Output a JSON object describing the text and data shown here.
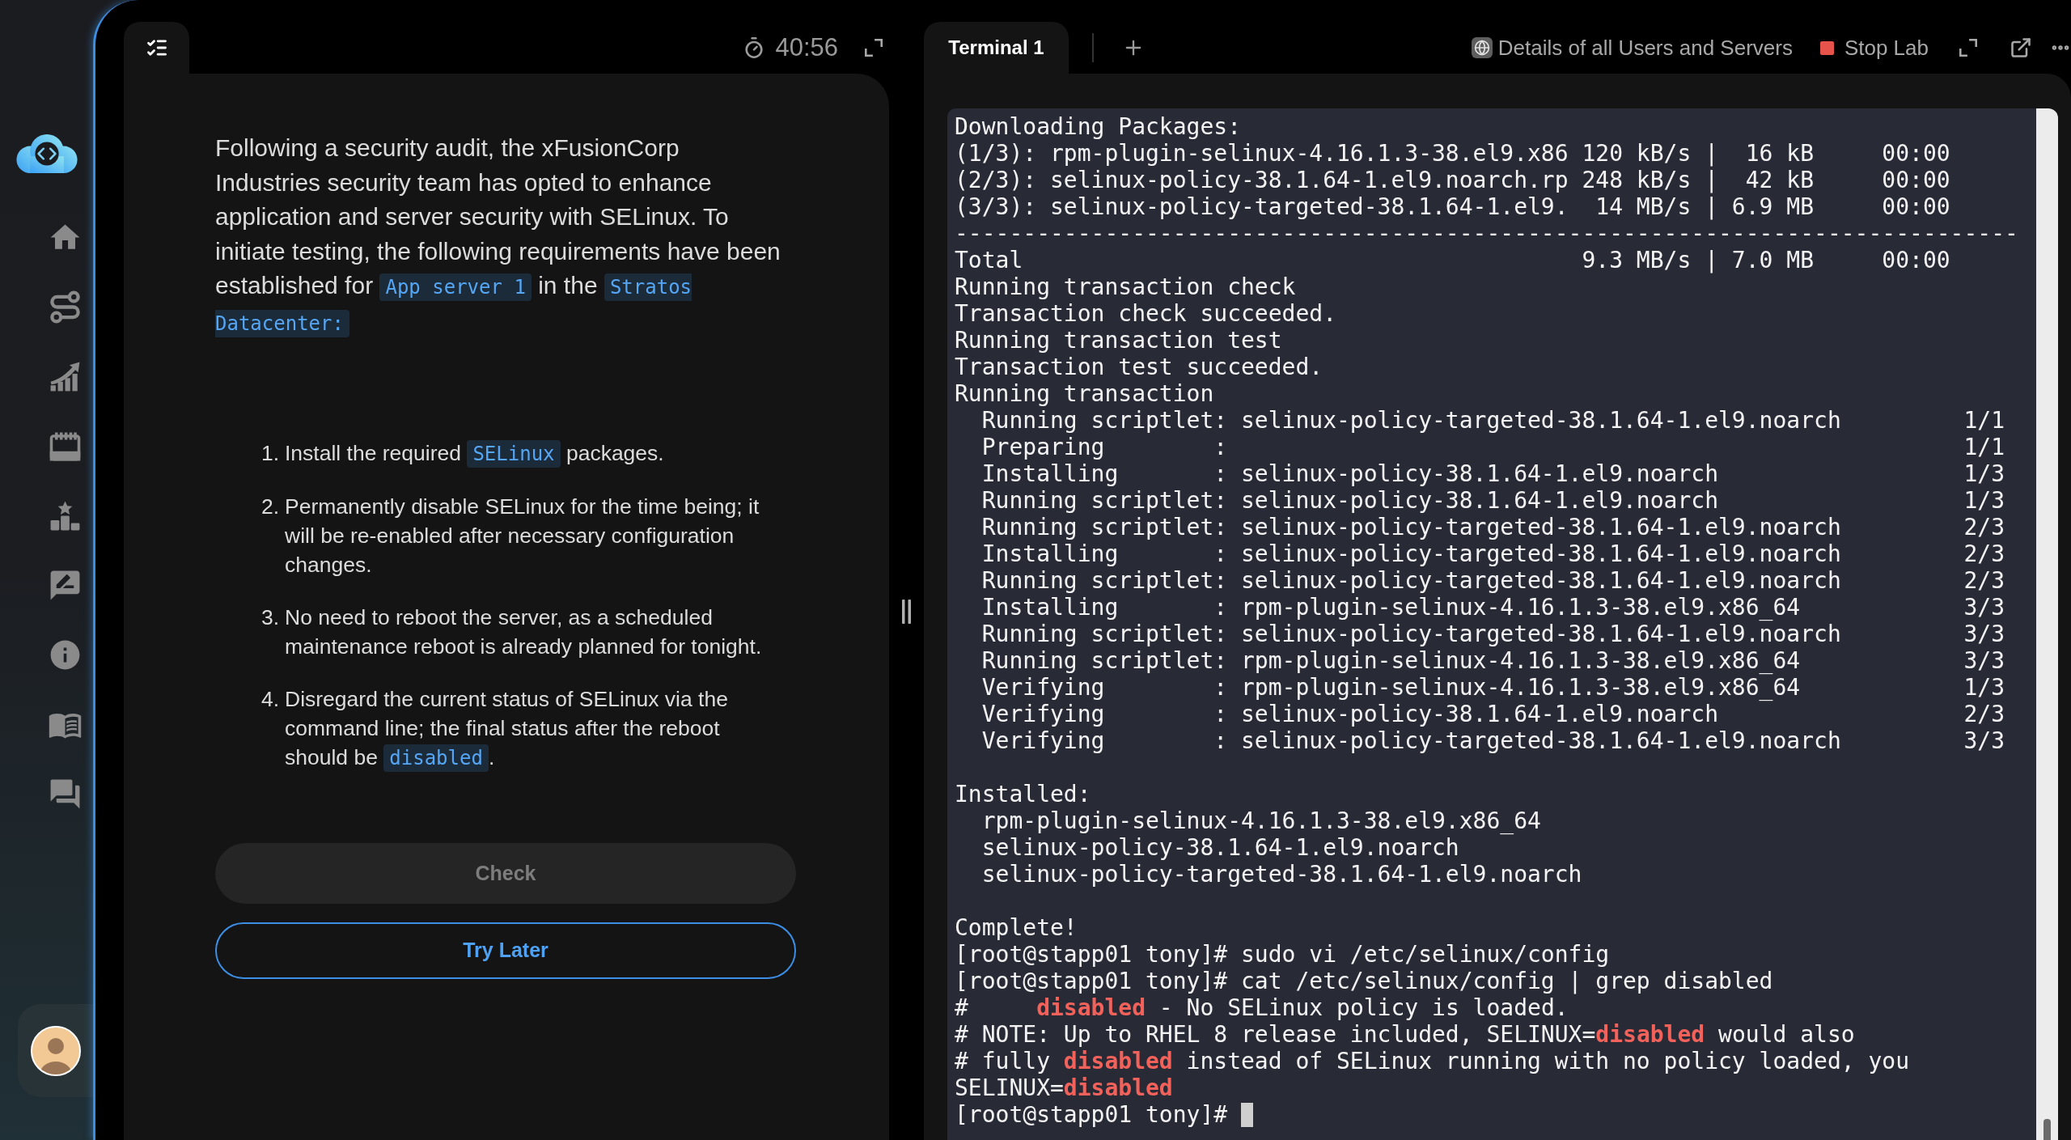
{
  "task_panel": {
    "timer": "40:56",
    "description": [
      {
        "kind": "text",
        "text": "Following a security audit, the xFusionCorp Industries security team has opted to enhance application and server security with SELinux. To initiate testing, the following requirements have been established for "
      },
      {
        "kind": "code",
        "text": "App server 1"
      },
      {
        "kind": "text",
        "text": " in the "
      },
      {
        "kind": "code",
        "text": "Stratos Datacenter:"
      }
    ],
    "steps": [
      {
        "number": "1.",
        "parts": [
          {
            "kind": "text",
            "text": "Install the required "
          },
          {
            "kind": "code",
            "text": "SELinux"
          },
          {
            "kind": "text",
            "text": " packages."
          }
        ]
      },
      {
        "number": "2.",
        "parts": [
          {
            "kind": "text",
            "text": "Permanently disable SELinux for the time being; it will be re-enabled after necessary configuration changes."
          }
        ]
      },
      {
        "number": "3.",
        "parts": [
          {
            "kind": "text",
            "text": "No need to reboot the server, as a scheduled maintenance reboot is already planned for tonight."
          }
        ]
      },
      {
        "number": "4.",
        "parts": [
          {
            "kind": "text",
            "text": "Disregard the current status of SELinux via the command line; the final status after the reboot should be "
          },
          {
            "kind": "code",
            "text": "disabled"
          },
          {
            "kind": "text",
            "text": "."
          }
        ]
      }
    ],
    "check_button": {
      "label": "Check",
      "disabled": true
    },
    "later_button": {
      "label": "Try Later"
    }
  },
  "terminal_panel": {
    "tabs": [
      {
        "label": "Terminal 1",
        "selected": true
      }
    ],
    "details_link": "Details of all Users and Servers",
    "stop_button": "Stop Lab",
    "lines": [
      {
        "kind": "text",
        "text": "Downloading Packages:"
      },
      {
        "kind": "text",
        "text": "(1/3): rpm-plugin-selinux-4.16.1.3-38.el9.x86 120 kB/s |  16 kB     00:00"
      },
      {
        "kind": "text",
        "text": "(2/3): selinux-policy-38.1.64-1.el9.noarch.rp 248 kB/s |  42 kB     00:00"
      },
      {
        "kind": "text",
        "text": "(3/3): selinux-policy-targeted-38.1.64-1.el9.  14 MB/s | 6.9 MB     00:00"
      },
      {
        "kind": "text",
        "text": "------------------------------------------------------------------------------"
      },
      {
        "kind": "text",
        "text": "Total                                         9.3 MB/s | 7.0 MB     00:00"
      },
      {
        "kind": "text",
        "text": "Running transaction check"
      },
      {
        "kind": "text",
        "text": "Transaction check succeeded."
      },
      {
        "kind": "text",
        "text": "Running transaction test"
      },
      {
        "kind": "text",
        "text": "Transaction test succeeded."
      },
      {
        "kind": "text",
        "text": "Running transaction"
      },
      {
        "kind": "text",
        "text": "  Running scriptlet: selinux-policy-targeted-38.1.64-1.el9.noarch         1/1"
      },
      {
        "kind": "text",
        "text": "  Preparing        :                                                      1/1"
      },
      {
        "kind": "text",
        "text": "  Installing       : selinux-policy-38.1.64-1.el9.noarch                  1/3"
      },
      {
        "kind": "text",
        "text": "  Running scriptlet: selinux-policy-38.1.64-1.el9.noarch                  1/3"
      },
      {
        "kind": "text",
        "text": "  Running scriptlet: selinux-policy-targeted-38.1.64-1.el9.noarch         2/3"
      },
      {
        "kind": "text",
        "text": "  Installing       : selinux-policy-targeted-38.1.64-1.el9.noarch         2/3"
      },
      {
        "kind": "text",
        "text": "  Running scriptlet: selinux-policy-targeted-38.1.64-1.el9.noarch         2/3"
      },
      {
        "kind": "text",
        "text": "  Installing       : rpm-plugin-selinux-4.16.1.3-38.el9.x86_64            3/3"
      },
      {
        "kind": "text",
        "text": "  Running scriptlet: selinux-policy-targeted-38.1.64-1.el9.noarch         3/3"
      },
      {
        "kind": "text",
        "text": "  Running scriptlet: rpm-plugin-selinux-4.16.1.3-38.el9.x86_64            3/3"
      },
      {
        "kind": "text",
        "text": "  Verifying        : rpm-plugin-selinux-4.16.1.3-38.el9.x86_64            1/3"
      },
      {
        "kind": "text",
        "text": "  Verifying        : selinux-policy-38.1.64-1.el9.noarch                  2/3"
      },
      {
        "kind": "text",
        "text": "  Verifying        : selinux-policy-targeted-38.1.64-1.el9.noarch         3/3"
      },
      {
        "kind": "blank"
      },
      {
        "kind": "text",
        "text": "Installed:"
      },
      {
        "kind": "text",
        "text": "  rpm-plugin-selinux-4.16.1.3-38.el9.x86_64"
      },
      {
        "kind": "text",
        "text": "  selinux-policy-38.1.64-1.el9.noarch"
      },
      {
        "kind": "text",
        "text": "  selinux-policy-targeted-38.1.64-1.el9.noarch"
      },
      {
        "kind": "blank"
      },
      {
        "kind": "text",
        "text": "Complete!"
      },
      {
        "kind": "text",
        "text": "[root@stapp01 tony]# sudo vi /etc/selinux/config"
      },
      {
        "kind": "text",
        "text": "[root@stapp01 tony]# cat /etc/selinux/config | grep disabled"
      },
      {
        "kind": "mixed",
        "parts": [
          {
            "kind": "text",
            "text": "#     "
          },
          {
            "kind": "highlight",
            "text": "disabled"
          },
          {
            "kind": "text",
            "text": " - No SELinux policy is loaded."
          }
        ]
      },
      {
        "kind": "mixed",
        "parts": [
          {
            "kind": "text",
            "text": "# NOTE: Up to RHEL 8 release included, SELINUX="
          },
          {
            "kind": "highlight",
            "text": "disabled"
          },
          {
            "kind": "text",
            "text": " would also"
          }
        ]
      },
      {
        "kind": "mixed",
        "parts": [
          {
            "kind": "text",
            "text": "# fully "
          },
          {
            "kind": "highlight",
            "text": "disabled"
          },
          {
            "kind": "text",
            "text": " instead of SELinux running with no policy loaded, you"
          }
        ]
      },
      {
        "kind": "mixed",
        "parts": [
          {
            "kind": "text",
            "text": "SELINUX="
          },
          {
            "kind": "highlight",
            "text": "disabled"
          }
        ]
      },
      {
        "kind": "text",
        "text": "[root@stapp01 tony]# ",
        "cursor": true
      }
    ]
  }
}
